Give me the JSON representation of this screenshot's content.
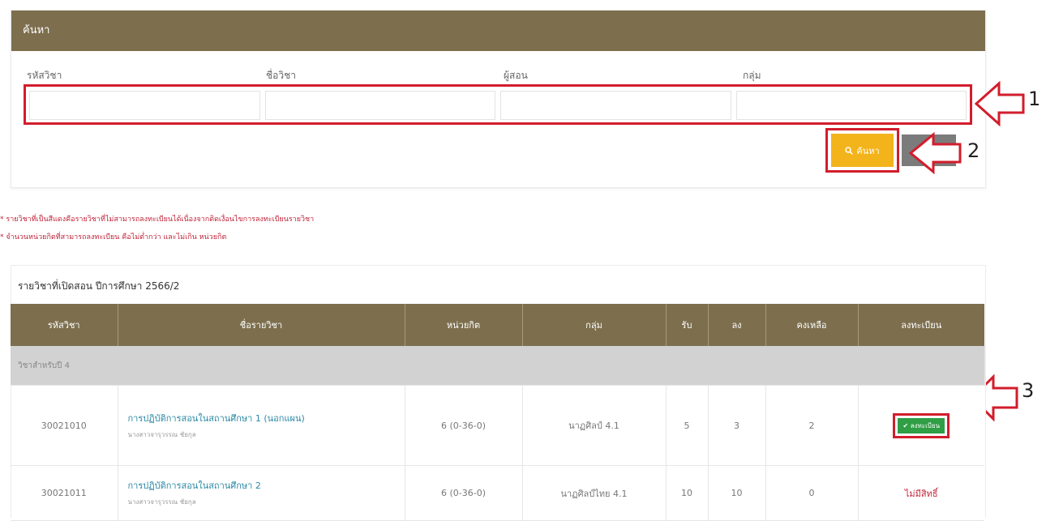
{
  "search": {
    "title": "ค้นหา",
    "labels": [
      "รหัสวิชา",
      "ชื่อวิชา",
      "ผู้สอน",
      "กลุ่ม"
    ],
    "values": [
      "",
      "",
      "",
      ""
    ],
    "search_button": "ค้นหา",
    "cancel_button": "ยกเลิก"
  },
  "callouts": [
    "1",
    "2",
    "3"
  ],
  "notes": [
    "* รายวิชาที่เป็นสีแดงคือรายวิชาที่ไม่สามารถลงทะเบียนได้เนื่องจากติดเงื่อนไขการลงทะเบียนรายวิชา",
    "* จำนวนหน่วยกิตที่สามารถลงทะเบียน คือไม่ต่ำกว่า และไม่เกิน หน่วยกิต"
  ],
  "list": {
    "title": "รายวิชาที่เปิดสอน ปีการศึกษา 2566/2",
    "headers": [
      "รหัสวิชา",
      "ชื่อรายวิชา",
      "หน่วยกิต",
      "กลุ่ม",
      "รับ",
      "ลง",
      "คงเหลือ",
      "ลงทะเบียน"
    ],
    "group_label": "วิชาสำหรับปี 4",
    "rows": [
      {
        "code": "30021010",
        "name": "การปฏิบัติการสอนในสถานศึกษา 1 (นอกแผน)",
        "teacher": "นางสาวจารุวรรณ ชัยกุล",
        "credits": "6 (0-36-0)",
        "group": "นาฏศิลป์ 4.1",
        "accept": "5",
        "enrolled": "3",
        "remaining": "2",
        "action": "ลงทะเบียน"
      },
      {
        "code": "30021011",
        "name": "การปฏิบัติการสอนในสถานศึกษา 2",
        "teacher": "นางสาวจารุวรรณ ชัยกุล",
        "credits": "6 (0-36-0)",
        "group": "นาฏศิลป์ไทย 4.1",
        "accept": "10",
        "enrolled": "10",
        "remaining": "0",
        "action": "ไม่มีสิทธิ์"
      }
    ]
  },
  "colors": {
    "header_bg": "#7d6f4e",
    "highlight_red": "#d21d2c",
    "search_yellow": "#f3b31b",
    "register_green": "#2f9e45",
    "link_blue": "#2b8aa5"
  },
  "icons": [
    "search-icon",
    "check-icon",
    "arrow-left-icon"
  ]
}
